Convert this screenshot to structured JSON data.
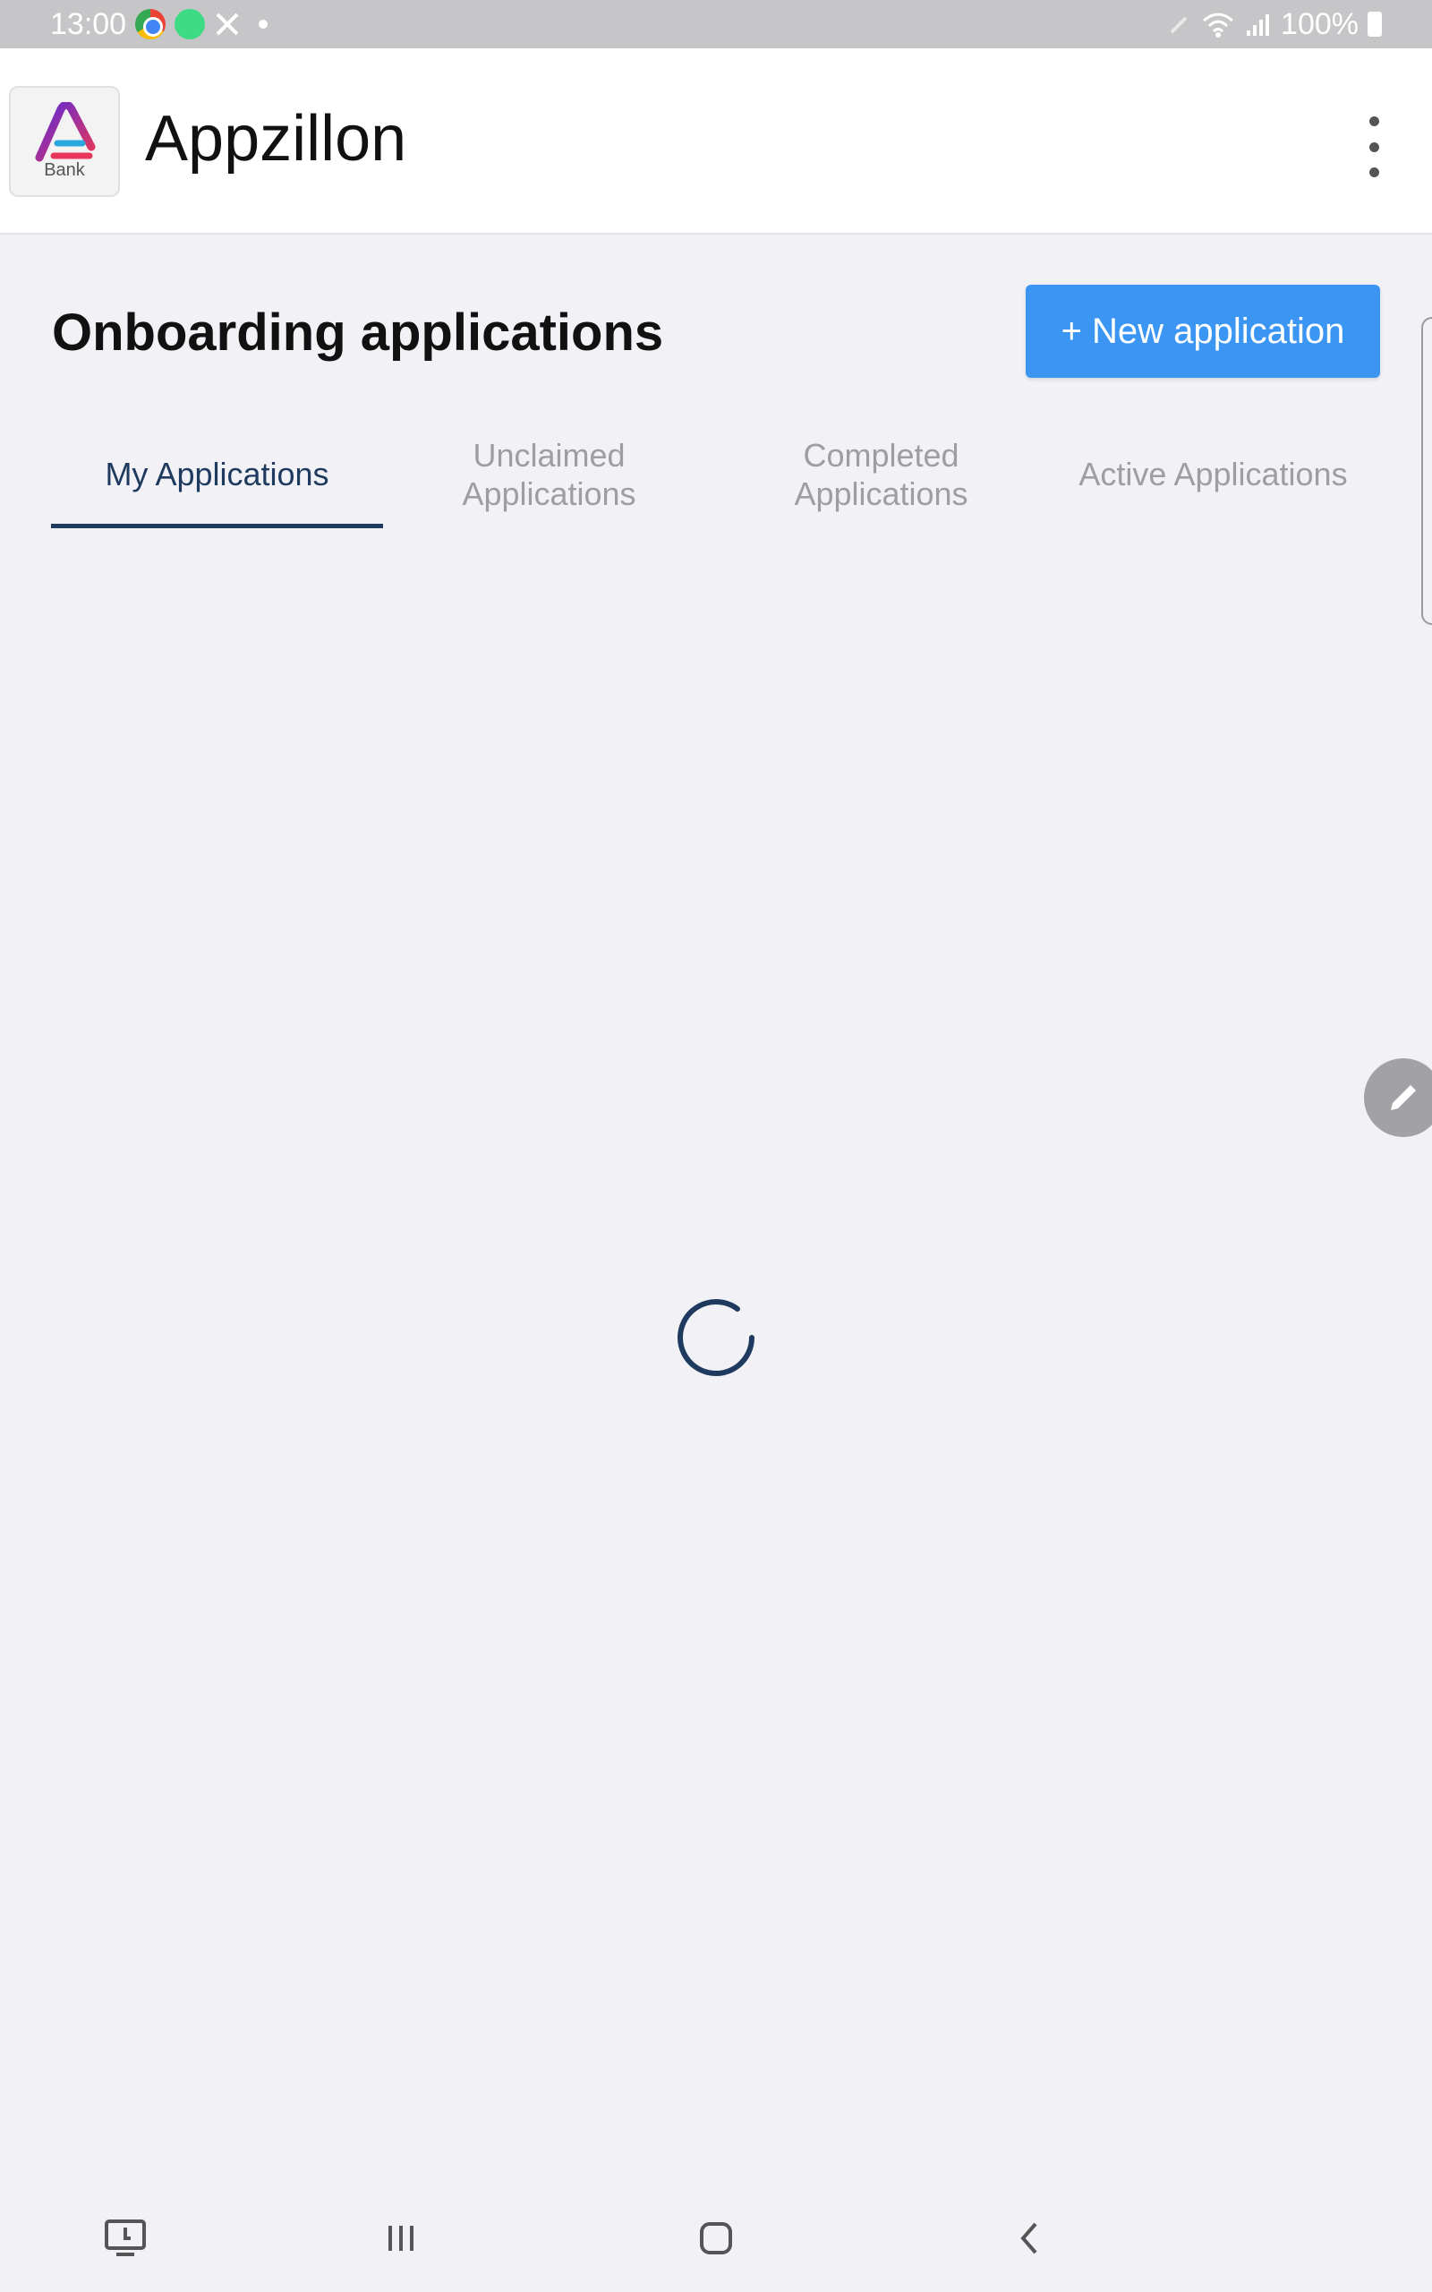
{
  "status_bar": {
    "time": "13:00",
    "battery": "100%",
    "icons": [
      "chrome-icon",
      "android-icon",
      "tools-icon",
      "dot-icon",
      "pen-icon",
      "wifi-icon",
      "signal-icon",
      "battery-icon"
    ]
  },
  "app_bar": {
    "title": "Appzillon",
    "logo_text": "Bank",
    "menu_icon": "more-vertical-icon"
  },
  "header": {
    "title": "Onboarding applications",
    "new_button_label": "+ New application"
  },
  "tabs": [
    {
      "label": "My Applications",
      "active": true
    },
    {
      "label": "Unclaimed Applications",
      "active": false
    },
    {
      "label": "Completed Applications",
      "active": false
    },
    {
      "label": "Active Applications",
      "active": false
    }
  ],
  "floating_action": "pencil-icon",
  "loading": true,
  "nav_bar": [
    "screenshot-icon",
    "recents-icon",
    "home-icon",
    "back-icon"
  ],
  "colors": {
    "accent": "#3b96f3",
    "active_tab": "#1f3a5f",
    "inactive_tab": "#9d9da3",
    "background": "#f2f2f6"
  }
}
